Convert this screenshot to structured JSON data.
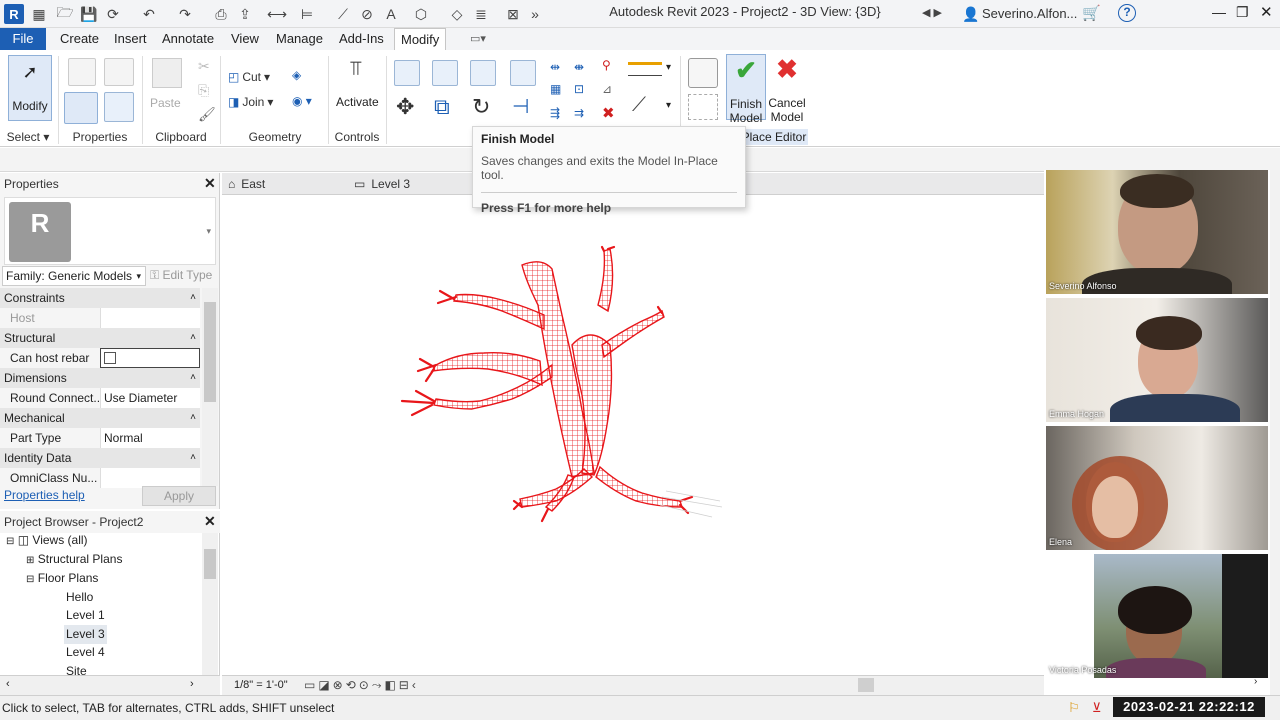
{
  "window": {
    "title": "Autodesk Revit 2023 - Project2 - 3D View: {3D}",
    "user": "Severino.Alfon...",
    "help": "?"
  },
  "app": {
    "logo_letter": "R"
  },
  "tabs": [
    {
      "label": "File"
    },
    {
      "label": "Create"
    },
    {
      "label": "Insert"
    },
    {
      "label": "Annotate"
    },
    {
      "label": "View"
    },
    {
      "label": "Manage"
    },
    {
      "label": "Add-Ins"
    },
    {
      "label": "Modify"
    }
  ],
  "ribbon": {
    "modify_label": "Modify",
    "paste_label": "Paste",
    "cut_label": "Cut",
    "join_label": "Join",
    "activate_label": "Activate",
    "finish_label_1": "Finish",
    "finish_label_2": "Model",
    "cancel_label_1": "Cancel",
    "cancel_label_2": "Model",
    "panels": {
      "select": "Select",
      "properties": "Properties",
      "clipboard": "Clipboard",
      "geometry": "Geometry",
      "controls": "Controls",
      "inplace": "Place Editor"
    }
  },
  "tooltip": {
    "title": "Finish Model",
    "description": "Saves changes and exits the Model In-Place tool.",
    "help": "Press F1 for more help"
  },
  "view_tabs": [
    {
      "label": "East"
    },
    {
      "label": "Level 3"
    }
  ],
  "properties": {
    "title": "Properties",
    "type_letter": "R",
    "family": "Family: Generic Models",
    "edit_type": "Edit Type",
    "sections": {
      "constraints": "Constraints",
      "structural": "Structural",
      "dimensions": "Dimensions",
      "mechanical": "Mechanical",
      "identity": "Identity Data"
    },
    "rows": {
      "host": {
        "key": "Host",
        "value": ""
      },
      "can_host_rebar": {
        "key": "Can host rebar",
        "checked": false
      },
      "round_connection": {
        "key": "Round Connect...",
        "value": "Use Diameter"
      },
      "part_type": {
        "key": "Part Type",
        "value": "Normal"
      },
      "omniclass": {
        "key": "OmniClass Nu...",
        "value": ""
      }
    },
    "help_link": "Properties help",
    "apply": "Apply"
  },
  "browser": {
    "title": "Project Browser - Project2",
    "items": [
      {
        "label": "Views (all)"
      },
      {
        "label": "Structural Plans"
      },
      {
        "label": "Floor Plans"
      },
      {
        "label": "Hello"
      },
      {
        "label": "Level 1"
      },
      {
        "label": "Level 3"
      },
      {
        "label": "Level 4"
      },
      {
        "label": "Site"
      }
    ]
  },
  "viewbar": {
    "scale": "1/8\" = 1'-0\""
  },
  "status": {
    "text": "Click to select, TAB for alternates, CTRL adds, SHIFT unselect"
  },
  "clock": "2023-02-21  22:22:12",
  "participants": [
    {
      "name": "Severino Alfonso"
    },
    {
      "name": "Emma Hogan"
    },
    {
      "name": "Elena"
    },
    {
      "name": "Victoria Posadas"
    }
  ],
  "colors": {
    "accent": "#1d5fb4",
    "model": "#e8161a",
    "finish": "#3aa63a",
    "cancel": "#e03030"
  }
}
